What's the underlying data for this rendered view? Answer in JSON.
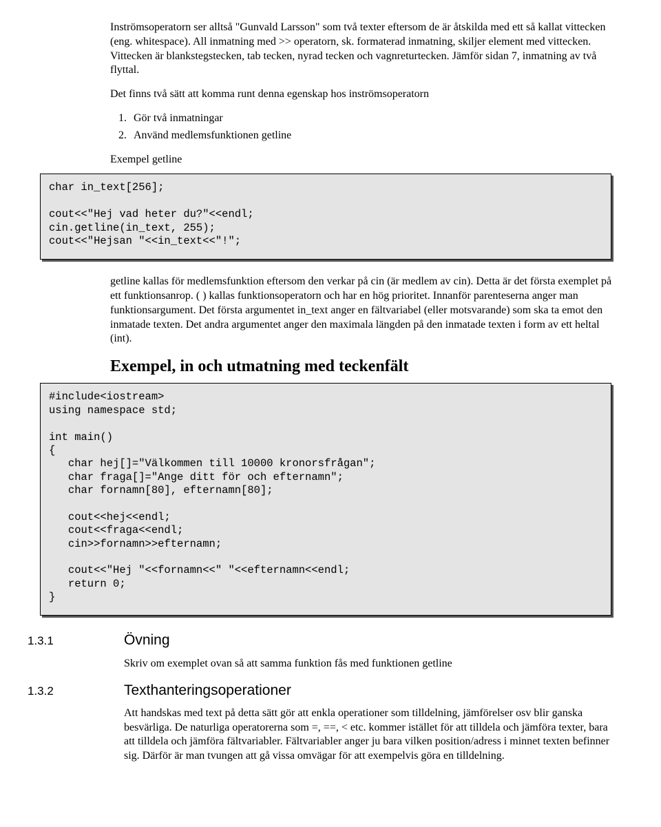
{
  "p1": "Inströmsoperatorn ser alltså \"Gunvald Larsson\" som två texter eftersom de är åtskilda med ett så kallat vittecken (eng. whitespace). All inmatning med >> operatorn, sk. formaterad inmatning, skiljer element med vittecken. Vittecken är blankstegstecken, tab tecken, nyrad tecken och vagnreturtecken. Jämför sidan 7, inmatning av två flyttal.",
  "p2": "Det finns två sätt att komma runt denna egenskap hos inströmsoperatorn",
  "li1": "Gör två inmatningar",
  "li2": "Använd medlemsfunktionen getline",
  "p3": "Exempel getline",
  "code1": "char in_text[256];\n\ncout<<\"Hej vad heter du?\"<<endl;\ncin.getline(in_text, 255);\ncout<<\"Hejsan \"<<in_text<<\"!\";",
  "p4": "getline kallas för medlemsfunktion eftersom den verkar på cin (är medlem av cin). Detta är det första exemplet på ett funktionsanrop. ( ) kallas funktionsoperatorn och har en hög prioritet. Innanför parenteserna anger man funktionsargument. Det första argumentet in_text anger en fältvariabel (eller motsvarande) som ska ta emot den inmatade texten. Det andra argumentet anger den maximala längden på den inmatade texten i form av ett heltal (int).",
  "h2a": "Exempel, in och utmatning med teckenfält",
  "code2": "#include<iostream>\nusing namespace std;\n\nint main()\n{\n   char hej[]=\"Välkommen till 10000 kronorsfrågan\";\n   char fraga[]=\"Ange ditt för och efternamn\";\n   char fornamn[80], efternamn[80];\n\n   cout<<hej<<endl;\n   cout<<fraga<<endl;\n   cin>>fornamn>>efternamn;\n\n   cout<<\"Hej \"<<fornamn<<\" \"<<efternamn<<endl;\n   return 0;\n}",
  "s131_num": "1.3.1",
  "s131_title": "Övning",
  "s131_body": "Skriv om exemplet ovan så att samma funktion fås med funktionen getline",
  "s132_num": "1.3.2",
  "s132_title": "Texthanteringsoperationer",
  "s132_body": "Att handskas med text på detta sätt gör att enkla operationer som tilldelning, jämförelser osv blir ganska besvärliga. De naturliga operatorerna som =, ==, < etc. kommer istället för att tilldela och jämföra texter, bara att tilldela och jämföra fältvariabler. Fältvariabler anger ju bara vilken position/adress i minnet texten befinner sig. Därför är man tvungen att gå vissa omvägar för att exempelvis göra en tilldelning."
}
